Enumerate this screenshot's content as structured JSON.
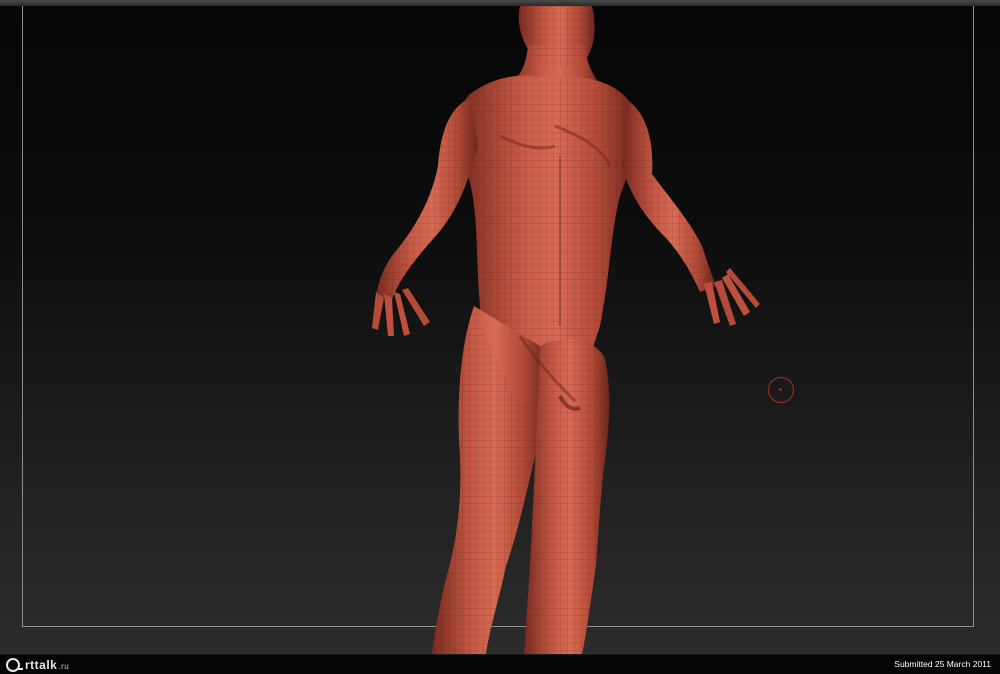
{
  "viewport": {
    "background_top": "#060606",
    "background_bottom": "#2c2c2c",
    "frame_color": "#8e8e8e",
    "model_color": "#c0503e",
    "brush_cursor_color": "#b12a1f"
  },
  "footer": {
    "logo_icon": "artalk-logo-icon",
    "logo_name": "rttalk",
    "logo_tld": ".ru",
    "submitted_text": "Submitted 25 March 2011"
  }
}
